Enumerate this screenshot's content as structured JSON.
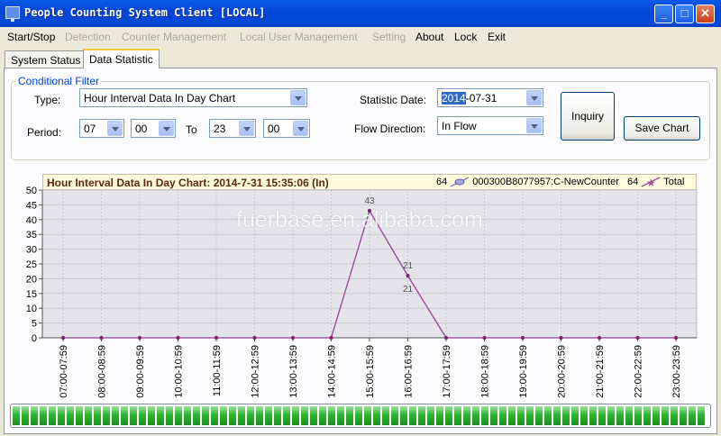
{
  "window": {
    "title": "People Counting System Client [LOCAL]"
  },
  "menu": [
    {
      "label": "Start/Stop",
      "enabled": true
    },
    {
      "label": "Detection",
      "enabled": false
    },
    {
      "label": "Counter Management",
      "enabled": false
    },
    {
      "label": "Local User Management",
      "enabled": false
    },
    {
      "label": "Setting",
      "enabled": false
    },
    {
      "label": "About",
      "enabled": true
    },
    {
      "label": "Lock",
      "enabled": true
    },
    {
      "label": "Exit",
      "enabled": true
    }
  ],
  "tabs": [
    {
      "label": "System Status",
      "active": false
    },
    {
      "label": "Data Statistic",
      "active": true
    }
  ],
  "filter": {
    "legend": "Conditional Filter",
    "type_label": "Type:",
    "type_value": "Hour Interval Data In Day Chart",
    "period_label": "Period:",
    "period_from_hour": "07",
    "period_from_min": "00",
    "to_label": "To",
    "period_to_hour": "23",
    "period_to_min": "00",
    "date_label": "Statistic Date:",
    "date_year": "2014",
    "date_rest": "-07-31",
    "flow_label": "Flow Direction:",
    "flow_value": "In Flow",
    "inquiry_label": "Inquiry",
    "save_chart_label": "Save Chart"
  },
  "chart_header": {
    "title": "Hour Interval Data In Day Chart: 2014-7-31 15:35:06 (In)",
    "legend": [
      {
        "count": "64",
        "name": "000300B8077957:C-NewCounter",
        "icon": "device-line-icon",
        "color": "#8080c0"
      },
      {
        "count": "64",
        "name": "Total",
        "icon": "star-line-icon",
        "color": "#a0509a"
      }
    ]
  },
  "watermark": "fuerbase.en.alibaba.com",
  "progress": {
    "value": 1.0,
    "color": "#2fb52f"
  },
  "chart_data": {
    "type": "line",
    "categories": [
      "07:00-07:59",
      "08:00-08:59",
      "09:00-09:59",
      "10:00-10:59",
      "11:00-11:59",
      "12:00-12:59",
      "13:00-13:59",
      "14:00-14:59",
      "15:00-15:59",
      "16:00-16:59",
      "17:00-17:59",
      "18:00-18:59",
      "19:00-19:59",
      "20:00-20:59",
      "21:00-21:59",
      "22:00-22:59",
      "23:00-23:59"
    ],
    "series": [
      {
        "name": "000300B8077957:C-NewCounter",
        "values": [
          0,
          0,
          0,
          0,
          0,
          0,
          0,
          0,
          43,
          21,
          0,
          0,
          0,
          0,
          0,
          0,
          0
        ],
        "color": "#8080c0"
      },
      {
        "name": "Total",
        "values": [
          0,
          0,
          0,
          0,
          0,
          0,
          0,
          0,
          43,
          21,
          0,
          0,
          0,
          0,
          0,
          0,
          0
        ],
        "color": "#a0509a"
      }
    ],
    "data_labels": [
      {
        "category": "15:00-15:59",
        "text": "43"
      },
      {
        "category": "16:00-16:59",
        "text": "21"
      },
      {
        "category": "16:00-16:59",
        "text": "21"
      }
    ],
    "y_ticks": [
      0,
      5,
      10,
      15,
      20,
      25,
      30,
      35,
      40,
      45,
      50
    ],
    "ylim": [
      0,
      50
    ],
    "grid": true
  }
}
